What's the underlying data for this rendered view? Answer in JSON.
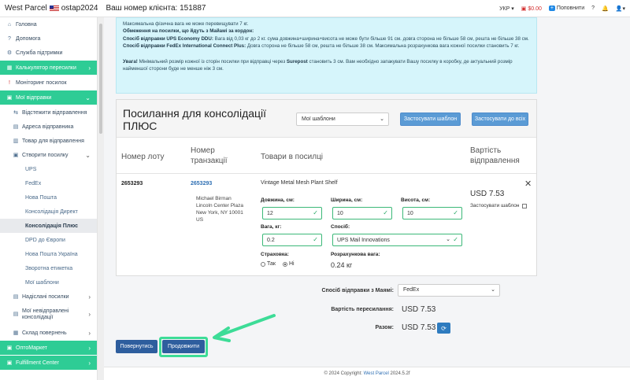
{
  "header": {
    "brand": "West Parcel",
    "username": "ostap2024",
    "client_label": "Ваш номер клієнта: 151887",
    "language": "УКР",
    "balance": "$0.00",
    "topup": "Поповнити"
  },
  "sidebar": {
    "items": [
      {
        "label": "Головна",
        "icon": "home-icon"
      },
      {
        "label": "Допомога",
        "icon": "question-icon"
      },
      {
        "label": "Служба підтримки",
        "icon": "support-icon"
      },
      {
        "label": "Калькулятор пересилки",
        "icon": "calculator-icon"
      },
      {
        "label": "Моніторинг посилок",
        "icon": "alert-icon"
      },
      {
        "label": "Мої відправки",
        "icon": "box-icon"
      },
      {
        "label": "Відстежити відправлення",
        "icon": "track-icon"
      },
      {
        "label": "Адреса відправника",
        "icon": "address-icon"
      },
      {
        "label": "Товар для відправлення",
        "icon": "product-icon"
      },
      {
        "label": "Створити посилку",
        "icon": "create-icon"
      },
      {
        "label": "UPS"
      },
      {
        "label": "FedEx"
      },
      {
        "label": "Нова Пошта"
      },
      {
        "label": "Консолідація Директ"
      },
      {
        "label": "Консолідація Плюс"
      },
      {
        "label": "DPD до Європи"
      },
      {
        "label": "Нова Пошта Україна"
      },
      {
        "label": "Зворотна етикетка"
      },
      {
        "label": "Мої шаблони"
      },
      {
        "label": "Надіслані посилки",
        "icon": "sent-icon"
      },
      {
        "label": "Мої невідправлені консолідації",
        "icon": "unsent-icon"
      },
      {
        "label": "Склад повернень",
        "icon": "warehouse-icon"
      },
      {
        "label": "ОптоМаркет",
        "icon": "market-icon"
      },
      {
        "label": "Fulfillment Center",
        "icon": "fulfillment-icon"
      }
    ]
  },
  "info": {
    "line0": "Максимальна фізична вага не може перевищувати 7 кг.",
    "heading": "Обмеження на посилки, що йдуть з Майамі за кордон:",
    "ups_label": "Спосіб відправки UPS Economy DDU:",
    "ups_text": "Вага від 0,03 кг до 2 кг. сума довжина+ширина+висота не може бути більше 91 см. довга сторона не більше 58 см, решта не більше 38 см.",
    "fedex_label": "Спосіб відправки FedEx International Connect Plus:",
    "fedex_text": "Довга сторона не більше 58 см, решта не більше 38 см. Максимальна розрахункова вага кожної посилки становить 7 кг.",
    "warn_label": "Увага!",
    "warn_text_1": "Мінімальний розмір кожної із сторін посилки при відправці через",
    "warn_bold": "Surepost",
    "warn_text_2": "становить 3 см. Вам необхідно запакувати Вашу посилку в коробку, де актуальний розмір найменшої сторони буде не менше ніж 3 см."
  },
  "card": {
    "title": "Посилання для консолідації ПЛЮС",
    "template_select": "Мої шаблони",
    "apply_template_btn": "Застосувати шаблон",
    "apply_all_btn": "Застосувати до всіх",
    "columns": {
      "lot": "Номер лоту",
      "txn": "Номер транзакції",
      "goods": "Товари в посилці",
      "cost": "Вартість відправлення"
    },
    "row": {
      "lot": "2653293",
      "txn": "2653293",
      "addr1": "Michael Birman",
      "addr2": "Lincoln Center Plaza",
      "addr3": "New York, NY 10001",
      "addr4": "US",
      "product": "Vintage Metal Mesh Plant Shelf",
      "length_label": "Довжина, см:",
      "length": "12",
      "width_label": "Ширина, см:",
      "width": "10",
      "height_label": "Висота, см:",
      "height": "10",
      "weight_label": "Вага, кг:",
      "weight": "0.2",
      "method_label": "Спосіб:",
      "method": "UPS Mail Innovations",
      "insurance_label": "Страховка:",
      "yes": "Так",
      "no": "Ні",
      "calc_weight_label": "Розрахункова вага:",
      "calc_weight": "0.24 кг",
      "price": "USD 7.53",
      "apply_template": "Застосувати шаблон"
    }
  },
  "summary": {
    "ship_method_label": "Спосіб відправки з Маямі:",
    "ship_method": "FedEx",
    "forward_cost_label": "Вартість пересилання:",
    "forward_cost": "USD 7.53",
    "total_label": "Разом:",
    "total": "USD 7.53"
  },
  "actions": {
    "back": "Повернутись",
    "next": "Продовжити"
  },
  "footer": {
    "text": "© 2024 Copyright:",
    "link": "West Parcel",
    "version": "2024.5.2f"
  }
}
